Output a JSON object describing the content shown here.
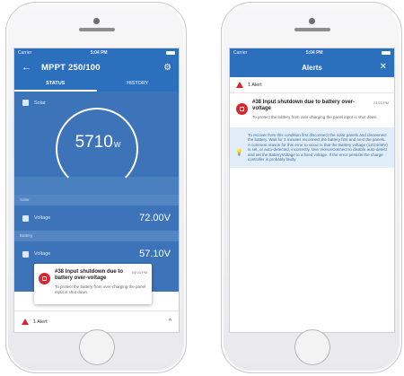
{
  "left_phone": {
    "status_bar": {
      "carrier": "Carrier",
      "time": "5:04 PM"
    },
    "app_bar": {
      "title": "MPPT 250/100",
      "back_icon": "arrow-left-icon",
      "settings_icon": "gear-icon"
    },
    "tabs": [
      {
        "label": "STATUS",
        "active": true
      },
      {
        "label": "HISTORY",
        "active": false
      }
    ],
    "solar": {
      "label": "Solar",
      "value": "5710",
      "unit": "W"
    },
    "sections": [
      {
        "header": "Solar",
        "rows": [
          {
            "label": "Voltage",
            "value": "72.00V"
          }
        ]
      },
      {
        "header": "Battery",
        "rows": [
          {
            "label": "Voltage",
            "value": "57.10V"
          }
        ]
      }
    ],
    "toast": {
      "title": "#38 Input shutdown due to battery over-voltage",
      "time": "05:03 PM",
      "text": "To protect the battery from over-charging the panel input is shut down."
    },
    "alert_bar": {
      "label": "1 Alert"
    }
  },
  "right_phone": {
    "status_bar": {
      "carrier": "Carrier",
      "time": "5:04 PM"
    },
    "app_bar": {
      "title": "Alerts",
      "close_icon": "close-icon"
    },
    "alert_header": {
      "label": "1 Alert"
    },
    "alert": {
      "title": "#38 Input shutdown due to battery over-voltage",
      "time": "23:53 PM",
      "text": "To protect the battery from over-charging the panel input is shut down."
    },
    "hint": {
      "text": "To recover from this condition first disconnect the solar panels and disconnect the battery. Wait for 3 minutes reconnect the battery first and next the panels. A common reason for this error to occur is that the Battery voltage (12/24/48V) is set, or auto-detected, incorrectly. Use VictronConnect to disable auto-detect and set the BatteryVoltage to a fixed voltage. If the error persists the charge controller is probably faulty."
    }
  },
  "colors": {
    "primary": "#2c6fbd",
    "panel": "#3d74b9",
    "alert": "#d9262e",
    "hint_bg": "#e1eef9"
  }
}
